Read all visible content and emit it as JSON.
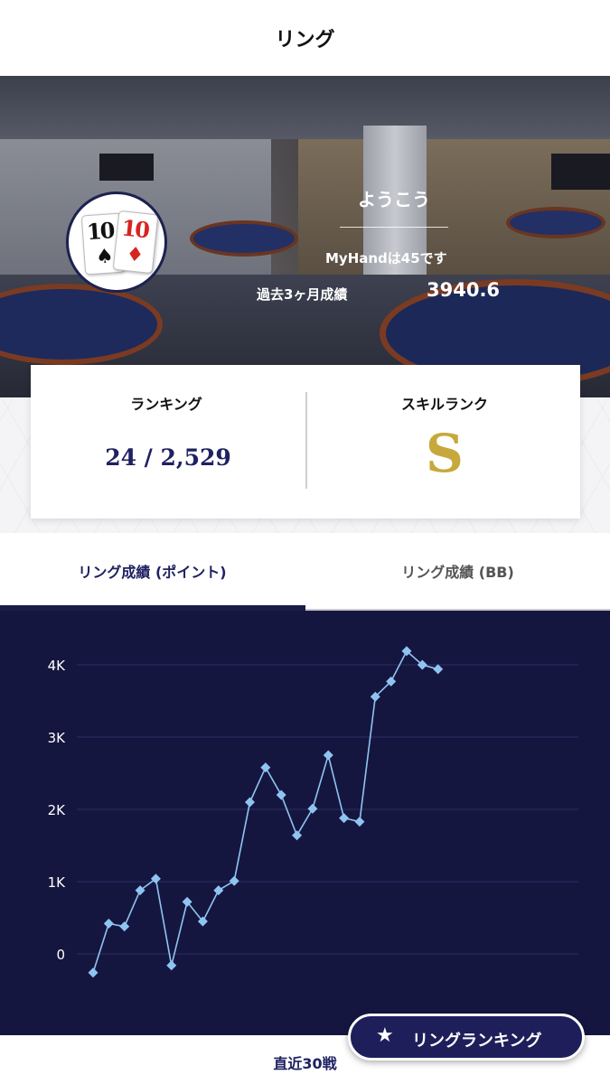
{
  "header": {
    "title": "リング"
  },
  "profile": {
    "avatar_cards": [
      {
        "rank": "10",
        "suit": "♠",
        "color": "#111111"
      },
      {
        "rank": "10",
        "suit": "♦",
        "color": "#d8231f"
      }
    ],
    "greeting": "ようこう",
    "myhand_text": "MyHandは45です",
    "period_label": "過去3ヶ月成績",
    "period_value": "3940.6"
  },
  "stats": {
    "ranking_label": "ランキング",
    "ranking_value": "24 / 2,529",
    "skill_label": "スキルランク",
    "skill_value": "S"
  },
  "tabs": [
    {
      "label": "リング成績 (ポイント)",
      "active": true
    },
    {
      "label": "リング成績 (BB)",
      "active": false
    }
  ],
  "chart_data": {
    "type": "line",
    "title": "",
    "xlabel": "直近30戦",
    "ylabel": "",
    "ylim": [
      -350,
      4350
    ],
    "yticks": [
      0,
      1000,
      2000,
      3000,
      4000
    ],
    "ytick_labels": [
      "0",
      "1K",
      "2K",
      "3K",
      "4K"
    ],
    "grid": true,
    "series": [
      {
        "color": "#8fc4f2",
        "marker": "diamond",
        "values": [
          -260,
          420,
          380,
          880,
          1040,
          -160,
          720,
          450,
          880,
          1010,
          2100,
          2580,
          2200,
          1640,
          2010,
          2750,
          1880,
          1830,
          3560,
          3770,
          4190,
          4000,
          3940
        ]
      }
    ],
    "colors": {
      "background": "#15163f",
      "grid": "#2c2e64",
      "tick_label": "#ffffff"
    }
  },
  "footer": {
    "label": "直近30戦"
  },
  "fab": {
    "icon": "star-icon",
    "label": "リングランキング"
  }
}
